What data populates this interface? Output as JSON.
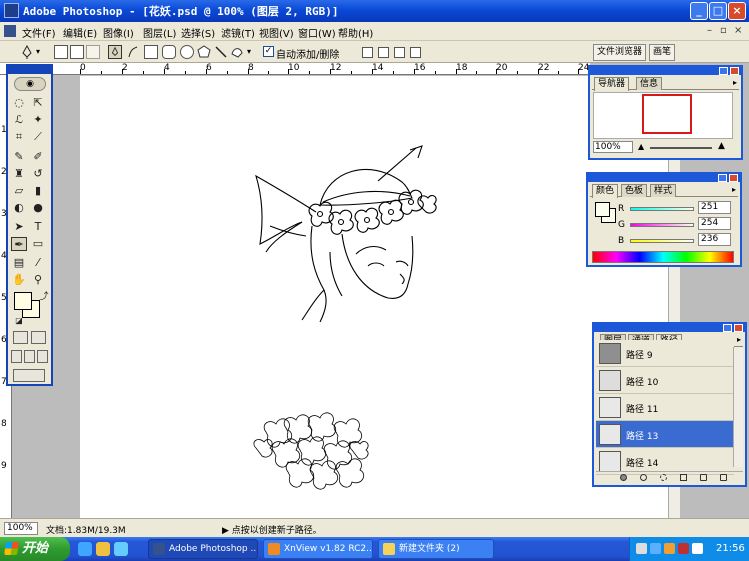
{
  "window": {
    "title": "Adobe Photoshop - [花妖.psd @ 100% (图层 2, RGB)]",
    "buttons": {
      "minimize": "_",
      "maximize": "□",
      "close": "×"
    }
  },
  "menu": {
    "items": [
      "文件(F)",
      "编辑(E)",
      "图像(I)",
      "图层(L)",
      "选择(S)",
      "滤镜(T)",
      "视图(V)",
      "窗口(W)",
      "帮助(H)"
    ],
    "mdi_controls": [
      "–",
      "▫",
      "×"
    ]
  },
  "options": {
    "auto_add_delete_checked": true,
    "auto_add_delete_label": "自动添加/删除",
    "check_mark": "✓",
    "palette_well": [
      "文件浏览器",
      "画笔"
    ]
  },
  "ruler": {
    "top_labels": [
      "0",
      "2",
      "4",
      "6",
      "8",
      "10",
      "12",
      "14",
      "16",
      "18",
      "20",
      "22",
      "24"
    ],
    "left_labels": [
      "1",
      "2",
      "3",
      "4",
      "5",
      "6",
      "7",
      "8",
      "9"
    ]
  },
  "navigator": {
    "tabs": [
      "导航器",
      "信息"
    ],
    "zoom": "100%"
  },
  "color": {
    "tabs": [
      "颜色",
      "色板",
      "样式"
    ],
    "channels": [
      {
        "name": "R",
        "value": "251"
      },
      {
        "name": "G",
        "value": "254"
      },
      {
        "name": "B",
        "value": "236"
      }
    ],
    "foreground": "#fbfeec"
  },
  "paths": {
    "tabs": [
      "图层",
      "通道",
      "路径"
    ],
    "items": [
      {
        "label": "路径 9",
        "active": false
      },
      {
        "label": "路径 10",
        "active": false
      },
      {
        "label": "路径 11",
        "active": false
      },
      {
        "label": "路径 13",
        "active": true
      },
      {
        "label": "路径 14",
        "active": false
      }
    ]
  },
  "status": {
    "zoom": "100%",
    "doc_info": "文档:1.83M/19.3M",
    "hint": "▶  点按以创建新子路径。"
  },
  "taskbar": {
    "start_label": "开始",
    "tasks": [
      {
        "label": "Adobe Photoshop ...",
        "active": true
      },
      {
        "label": "XnView v1.82 RC2...",
        "active": false
      },
      {
        "label": "新建文件夹 (2)",
        "active": false
      }
    ],
    "clock": "21:56"
  },
  "accent_colors": {
    "title_bar": "#0a4ad8",
    "palette_border": "#1d58d8",
    "taskbar": "#2352d0",
    "start": "#2f9b2f"
  }
}
